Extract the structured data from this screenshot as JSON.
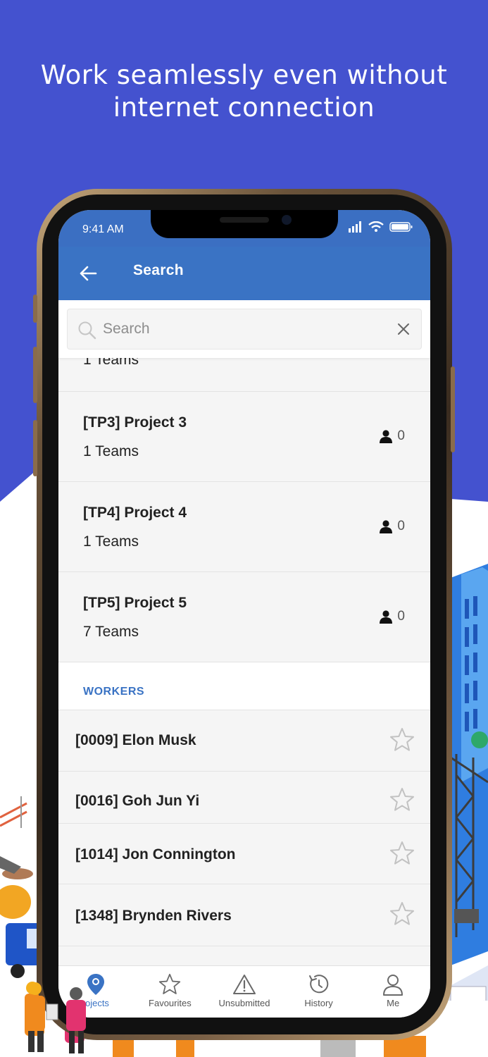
{
  "headline": {
    "line1": "Work seamlessly even without",
    "line2": "internet connection"
  },
  "colors": {
    "background_blue": "#4452cf",
    "app_bar": "#3a73c4",
    "accent": "#3a73c4"
  },
  "status_bar": {
    "time": "9:41 AM"
  },
  "app_bar": {
    "title": "Search"
  },
  "search": {
    "placeholder": "Search",
    "value": ""
  },
  "projects": {
    "partial_row_text": "1 Teams",
    "items": [
      {
        "name": "[TP3] Project 3",
        "teams": "1 Teams",
        "count": "0"
      },
      {
        "name": "[TP4] Project 4",
        "teams": "1 Teams",
        "count": "0"
      },
      {
        "name": "[TP5] Project 5",
        "teams": "7 Teams",
        "count": "0"
      }
    ]
  },
  "workers": {
    "header": "WORKERS",
    "items": [
      {
        "name": "[0009] Elon Musk"
      },
      {
        "name": "[0016] Goh Jun Yi"
      },
      {
        "name": "[1014] Jon Connington"
      },
      {
        "name": "[1348] Brynden Rivers"
      }
    ]
  },
  "tab_bar": {
    "items": [
      {
        "label": "rojects",
        "icon": "location-pin-icon",
        "active": true
      },
      {
        "label": "Favourites",
        "icon": "star-icon",
        "active": false
      },
      {
        "label": "Unsubmitted",
        "icon": "warning-icon",
        "active": false
      },
      {
        "label": "History",
        "icon": "history-icon",
        "active": false
      },
      {
        "label": "Me",
        "icon": "user-icon",
        "active": false
      }
    ]
  }
}
